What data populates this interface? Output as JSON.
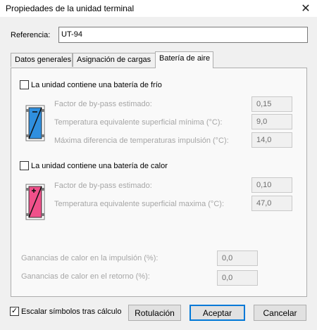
{
  "window": {
    "title": "Propiedades de la unidad terminal"
  },
  "reference": {
    "label": "Referencia:",
    "value": "UT-94"
  },
  "tabs": [
    {
      "label": "Datos generales",
      "active": false
    },
    {
      "label": "Asignación de cargas",
      "active": false
    },
    {
      "label": "Batería de aire",
      "active": true
    }
  ],
  "cold_coil": {
    "checkbox_label": "La unidad contiene una batería de frío",
    "checked": false,
    "icon": "cooling-coil-icon",
    "fields": [
      {
        "label": "Factor de by-pass estimado:",
        "value": "0,15"
      },
      {
        "label": "Temperatura equivalente superficial mínima (°C):",
        "value": "9,0"
      },
      {
        "label": "Máxima diferencia de temperaturas impulsión (°C):",
        "value": "14,0"
      }
    ]
  },
  "heat_coil": {
    "checkbox_label": "La unidad contiene una batería de calor",
    "checked": false,
    "icon": "heating-coil-icon",
    "fields": [
      {
        "label": "Factor de by-pass estimado:",
        "value": "0,10"
      },
      {
        "label": "Temperatura equivalente superficial maxima (°C):",
        "value": "47,0"
      }
    ]
  },
  "gains": [
    {
      "label": "Ganancias de calor en la impulsión (%):",
      "value": "0,0"
    },
    {
      "label": "Ganancias de calor en el retorno (%):",
      "value": "0,0"
    }
  ],
  "footer": {
    "scale_checkbox_label": "Escalar símbolos tras cálculo",
    "scale_checked": true,
    "check_mark": "✓",
    "rotulacion": "Rotulación",
    "accept": "Aceptar",
    "cancel": "Cancelar"
  },
  "colors": {
    "cold_coil": "#2f8fdf",
    "heat_coil": "#f0508a",
    "default_button_border": "#0078d7"
  }
}
